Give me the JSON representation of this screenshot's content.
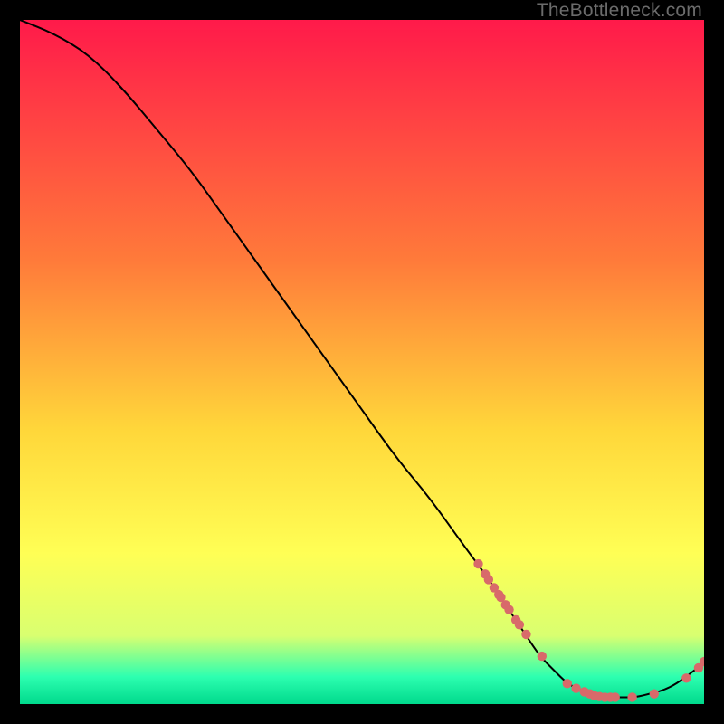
{
  "watermark": "TheBottleneck.com",
  "colors": {
    "gradient_top": "#ff1a4a",
    "gradient_mid1": "#ff7a3a",
    "gradient_mid2": "#ffd73a",
    "gradient_mid3": "#ffff55",
    "gradient_mid4": "#d9ff70",
    "gradient_bottom_band": "#2dffb0",
    "gradient_bottom": "#00d98c",
    "line": "#000000",
    "marker": "#d86a6a",
    "background": "#000000"
  },
  "chart_data": {
    "type": "line",
    "xlim": [
      0,
      100
    ],
    "ylim": [
      0,
      100
    ],
    "xlabel": "",
    "ylabel": "",
    "title": "",
    "series": [
      {
        "name": "curve",
        "x": [
          0,
          5,
          10,
          15,
          20,
          25,
          30,
          35,
          40,
          45,
          50,
          55,
          60,
          65,
          68,
          70,
          72,
          74,
          76,
          78,
          80,
          82,
          84,
          86,
          88,
          90,
          92,
          94,
          96,
          98,
          100
        ],
        "y": [
          100,
          98,
          95,
          90,
          84,
          78,
          71,
          64,
          57,
          50,
          43,
          36,
          30,
          23,
          19,
          16,
          13,
          10,
          7,
          5,
          3,
          2,
          1.5,
          1,
          1,
          1,
          1.5,
          2,
          3,
          4.5,
          6
        ]
      }
    ],
    "markers": {
      "name": "points",
      "x": [
        67,
        68,
        68.5,
        69.3,
        70,
        70.3,
        71,
        71.5,
        72.5,
        73,
        74,
        76.3,
        80,
        81.3,
        82.5,
        83.3,
        84,
        84.7,
        85.5,
        86.3,
        87,
        89.5,
        92.7,
        97.4,
        99.2,
        100
      ],
      "y": [
        20.5,
        19,
        18.2,
        17,
        16,
        15.6,
        14.5,
        13.8,
        12.3,
        11.6,
        10.2,
        7,
        3,
        2.3,
        1.8,
        1.5,
        1.2,
        1.1,
        1,
        1,
        1,
        1,
        1.5,
        3.8,
        5.3,
        6.2
      ]
    }
  }
}
